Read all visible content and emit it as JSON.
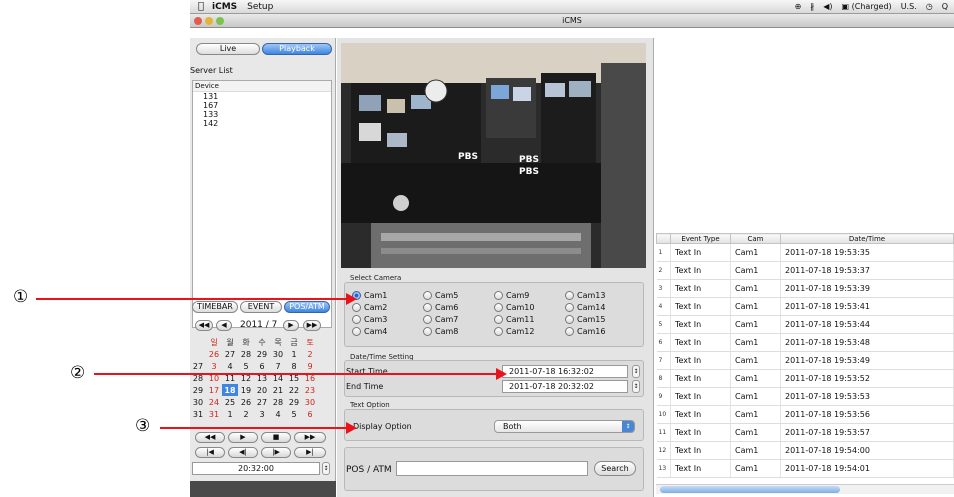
{
  "menubar": {
    "app_name": "iCMS",
    "menu_setup": "Setup",
    "status_items": [
      "⊕",
      "∦",
      "◀)",
      "▣ (Charged)",
      "U.S.",
      "◷",
      "Q"
    ]
  },
  "window": {
    "title": "iCMS"
  },
  "mode_tabs": {
    "live": "Live",
    "playback": "Playback"
  },
  "server_list": {
    "label": "Server List",
    "header": "Device",
    "devices": [
      "131",
      "167",
      "133",
      "142"
    ]
  },
  "search_tabs": {
    "timebar": "TIMEBAR",
    "event": "EVENT",
    "pos_atm": "POS/ATM"
  },
  "calendar": {
    "month_label": "2011 / 7",
    "weekdays": [
      "일",
      "월",
      "화",
      "수",
      "목",
      "금",
      "토"
    ],
    "weeks": [
      [
        "26",
        "27",
        "28",
        "29",
        "30",
        "1",
        "2"
      ],
      [
        "27",
        "3",
        "4",
        "5",
        "6",
        "7",
        "8",
        "9"
      ],
      [
        "28",
        "10",
        "11",
        "12",
        "13",
        "14",
        "15",
        "16"
      ],
      [
        "29",
        "17",
        "18",
        "19",
        "20",
        "21",
        "22",
        "23"
      ],
      [
        "30",
        "24",
        "25",
        "26",
        "27",
        "28",
        "29",
        "30"
      ],
      [
        "31",
        "31",
        "1",
        "2",
        "3",
        "4",
        "5",
        "6"
      ]
    ],
    "selected_day": "18"
  },
  "time_display": "20:32:00",
  "select_camera": {
    "label": "Select Camera",
    "cams": [
      "Cam1",
      "Cam5",
      "Cam9",
      "Cam13",
      "Cam2",
      "Cam6",
      "Cam10",
      "Cam14",
      "Cam3",
      "Cam7",
      "Cam11",
      "Cam15",
      "Cam4",
      "Cam8",
      "Cam12",
      "Cam16"
    ],
    "selected": "Cam1"
  },
  "datetime": {
    "label": "Date/Time Setting",
    "start_label": "Start Time",
    "start_value": "2011-07-18 16:32:02",
    "end_label": "End Time",
    "end_value": "2011-07-18 20:32:02"
  },
  "text_option": {
    "label": "Text Option",
    "display_label": "Display Option",
    "display_value": "Both"
  },
  "pos_atm": {
    "label": "POS / ATM",
    "search": "Search"
  },
  "event_table": {
    "columns": [
      "Event Type",
      "Cam",
      "Date/Time"
    ],
    "rows": [
      [
        "1",
        "Text In",
        "Cam1",
        "2011-07-18 19:53:35"
      ],
      [
        "2",
        "Text In",
        "Cam1",
        "2011-07-18 19:53:37"
      ],
      [
        "3",
        "Text In",
        "Cam1",
        "2011-07-18 19:53:39"
      ],
      [
        "4",
        "Text In",
        "Cam1",
        "2011-07-18 19:53:41"
      ],
      [
        "5",
        "Text In",
        "Cam1",
        "2011-07-18 19:53:44"
      ],
      [
        "6",
        "Text In",
        "Cam1",
        "2011-07-18 19:53:48"
      ],
      [
        "7",
        "Text In",
        "Cam1",
        "2011-07-18 19:53:49"
      ],
      [
        "8",
        "Text In",
        "Cam1",
        "2011-07-18 19:53:52"
      ],
      [
        "9",
        "Text In",
        "Cam1",
        "2011-07-18 19:53:53"
      ],
      [
        "10",
        "Text In",
        "Cam1",
        "2011-07-18 19:53:56"
      ],
      [
        "11",
        "Text In",
        "Cam1",
        "2011-07-18 19:53:57"
      ],
      [
        "12",
        "Text In",
        "Cam1",
        "2011-07-18 19:54:00"
      ],
      [
        "13",
        "Text In",
        "Cam1",
        "2011-07-18 19:54:01"
      ]
    ]
  },
  "annotations": [
    "①",
    "②",
    "③"
  ],
  "video_overlay": [
    "PBS",
    "PBS",
    "PBS"
  ],
  "colors": {
    "accent": "#3f86e0",
    "arrow": "#e8141c",
    "weekend_red": "#d0231d"
  }
}
